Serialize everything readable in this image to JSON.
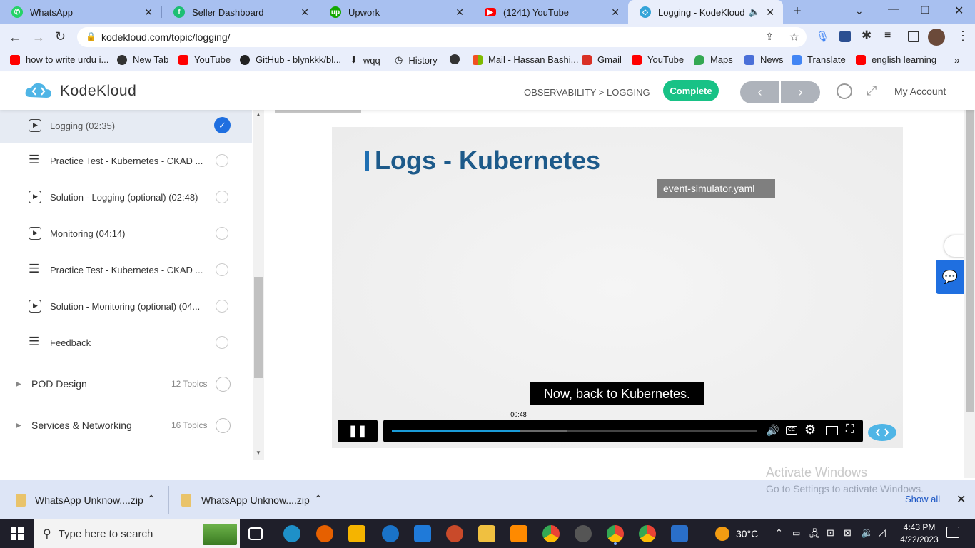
{
  "tabs": [
    {
      "label": "WhatsApp",
      "icon": "whatsapp-icon",
      "color": "#25d366"
    },
    {
      "label": "Seller Dashboard",
      "icon": "fiverr-icon",
      "color": "#1dbf73"
    },
    {
      "label": "Upwork",
      "icon": "upwork-icon",
      "color": "#14a800"
    },
    {
      "label": "(1241) YouTube",
      "icon": "youtube-icon",
      "color": "#ff0000"
    },
    {
      "label": "Logging - KodeKloud",
      "icon": "kodekloud-icon",
      "color": "#35a4d8"
    }
  ],
  "address": {
    "url": "kodekloud.com/topic/logging/"
  },
  "bookmarks": [
    {
      "label": "how to write urdu i...",
      "icon": "youtube-icon",
      "color": "#ff0000"
    },
    {
      "label": "New Tab",
      "icon": "globe-icon",
      "color": "#333333"
    },
    {
      "label": "YouTube",
      "icon": "youtube-icon",
      "color": "#ff0000"
    },
    {
      "label": "GitHub - blynkkk/bl...",
      "icon": "github-icon",
      "color": "#222222"
    },
    {
      "label": "wqq",
      "icon": "download-icon",
      "color": "#333333"
    },
    {
      "label": "History",
      "icon": "history-icon",
      "color": "#333333"
    },
    {
      "label": "",
      "icon": "globe-icon",
      "color": "#333333"
    },
    {
      "label": "Mail - Hassan Bashi...",
      "icon": "microsoft-icon",
      "color": "#f25022"
    },
    {
      "label": "Gmail",
      "icon": "gmail-icon",
      "color": "#d93025"
    },
    {
      "label": "YouTube",
      "icon": "youtube-icon",
      "color": "#ff0000"
    },
    {
      "label": "Maps",
      "icon": "maps-icon",
      "color": "#34a853"
    },
    {
      "label": "News",
      "icon": "news-icon",
      "color": "#4a6fd8"
    },
    {
      "label": "Translate",
      "icon": "translate-icon",
      "color": "#4285f4"
    },
    {
      "label": "english learning",
      "icon": "youtube-icon",
      "color": "#ff0000"
    }
  ],
  "header": {
    "brand": "KodeKloud",
    "breadcrumb": "OBSERVABILITY > LOGGING",
    "complete_label": "Complete",
    "account_label": "My Account",
    "prev_label": "‹",
    "next_label": "›"
  },
  "sidebar": {
    "lessons": [
      {
        "label": "Logging (02:35)",
        "type": "video",
        "done": true
      },
      {
        "label": "Practice Test - Kubernetes - CKAD ...",
        "type": "list",
        "done": false
      },
      {
        "label": "Solution - Logging (optional) (02:48)",
        "type": "video",
        "done": false
      },
      {
        "label": "Monitoring (04:14)",
        "type": "video",
        "done": false
      },
      {
        "label": "Practice Test - Kubernetes - CKAD ...",
        "type": "list",
        "done": false
      },
      {
        "label": "Solution - Monitoring (optional) (04...",
        "type": "video",
        "done": false
      },
      {
        "label": "Feedback",
        "type": "list",
        "done": false
      }
    ],
    "sections": [
      {
        "label": "POD Design",
        "count": "12 Topics"
      },
      {
        "label": "Services & Networking",
        "count": "16 Topics"
      }
    ]
  },
  "video": {
    "slide_title": "Logs - Kubernetes",
    "file_badge": "event-simulator.yaml",
    "subtitle": "Now, back to Kubernetes.",
    "time_tooltip": "00:48",
    "played_fraction": 0.35,
    "buffered_fraction": 0.48
  },
  "watermark": {
    "line1": "Activate Windows",
    "line2": "Go to Settings to activate Windows."
  },
  "downloads": {
    "items": [
      "WhatsApp Unknow....zip",
      "WhatsApp Unknow....zip"
    ],
    "show_all": "Show all"
  },
  "taskbar": {
    "search_placeholder": "Type here to search",
    "weather": "30°C",
    "time": "4:43 PM",
    "date": "4/22/2023"
  }
}
